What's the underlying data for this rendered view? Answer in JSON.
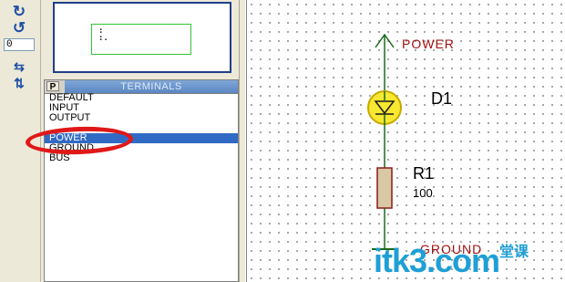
{
  "toolbar": {
    "rotate_cw_icon": "rotate-clockwise-icon",
    "rotate_ccw_icon": "rotate-counterclockwise-icon",
    "rotation_value": "0",
    "mirror_h_icon": "mirror-horizontal-icon",
    "mirror_v_icon": "mirror-vertical-icon"
  },
  "overview": {
    "glyph": ":\n:."
  },
  "selector": {
    "p_button": "P",
    "title": "TERMINALS",
    "items": [
      "DEFAULT",
      "INPUT",
      "OUTPUT",
      "",
      "POWER",
      "GROUND",
      "BUS"
    ],
    "selected": "POWER"
  },
  "schematic": {
    "power_label": "POWER",
    "d1_label": "D1",
    "r1_label": "R1",
    "r1_value": "100",
    "ground_label": "GROUND"
  },
  "watermark": {
    "text": "itk3.com",
    "sub": "堂课"
  },
  "colors": {
    "led_fill": "#f7e830",
    "resistor_fill": "#d8c8a4",
    "wire": "#1a6a1a",
    "highlight_ellipse": "#e01818",
    "selection": "#316ac5"
  }
}
